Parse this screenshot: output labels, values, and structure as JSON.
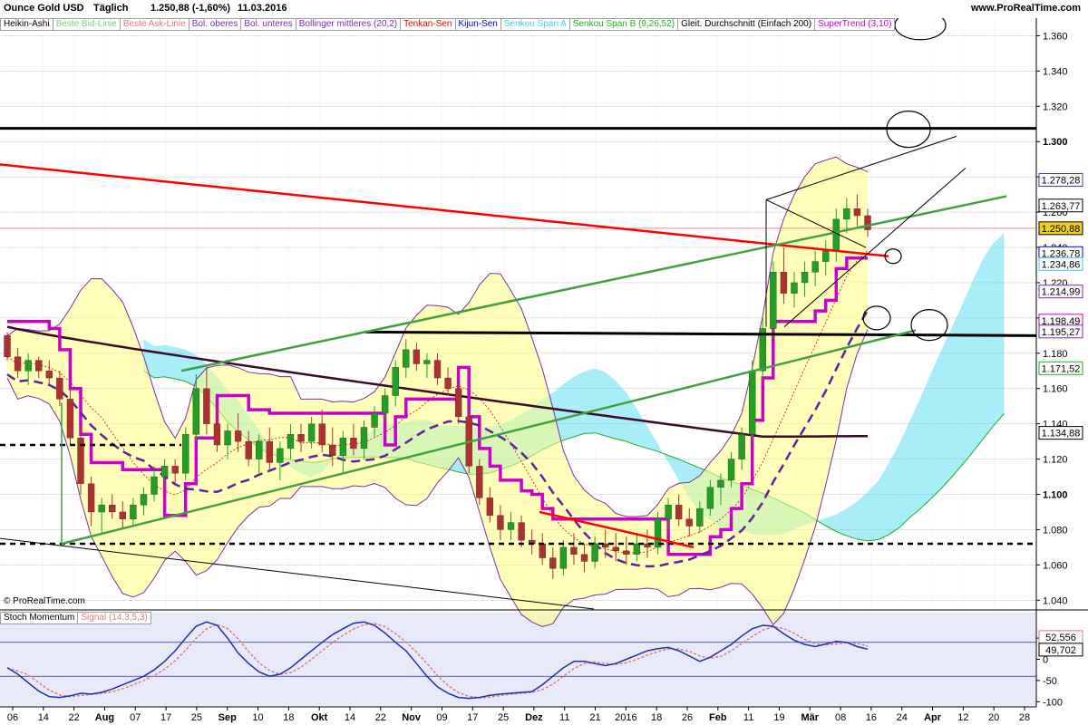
{
  "header": {
    "instrument": "Ounce Gold USD",
    "interval": "Täglich",
    "price": "1.250,88 (-1,60%)",
    "date": "11.03.2016",
    "site": "www.ProRealTime.com"
  },
  "copyright": "© ProRealTime.com",
  "legend": [
    {
      "label": "Heikin-Ashi",
      "color": "#000000"
    },
    {
      "label": "Beste Bid-Linie",
      "color": "#7ed07e"
    },
    {
      "label": "Beste Ask-Linie",
      "color": "#e07a7a"
    },
    {
      "label": "Bol. oberes",
      "color": "#7a2ea8"
    },
    {
      "label": "Bol. unteres",
      "color": "#7a2ea8"
    },
    {
      "label": "Bollinger mittleres (20,2)",
      "color": "#7a2ea8"
    },
    {
      "label": "Tenkan-Sen",
      "color": "#e00000"
    },
    {
      "label": "Kijun-Sen",
      "color": "#0000cc"
    },
    {
      "label": "Senkou Span A",
      "color": "#40d0f0"
    },
    {
      "label": "Senkou Span B (9,26,52)",
      "color": "#20b020"
    },
    {
      "label": "Gleit. Durchschnitt (Einfach 200)",
      "color": "#000000"
    },
    {
      "label": "SuperTrend (3,10)",
      "color": "#cc00cc"
    }
  ],
  "oscillator_legend": [
    {
      "label": "Stoch Momentum",
      "color": "#000000"
    },
    {
      "label": "Signal (14,3,5,3)",
      "color": "#e07a7a"
    }
  ],
  "chart_data": [
    {
      "type": "candlestick",
      "ylim": [
        1.035,
        1.37
      ],
      "y_ticks": [
        "1.040",
        "1.060",
        "1.080",
        "1.100",
        "1.120",
        "1.140",
        "1.160",
        "1.180",
        "1.200",
        "1.220",
        "1.240",
        "1.260",
        "1.280",
        "1.300",
        "1.320",
        "1.340",
        "1.360"
      ],
      "x_ticks": [
        "06",
        "14",
        "22",
        "Aug",
        "07",
        "17",
        "25",
        "Sep",
        "10",
        "18",
        "Okt",
        "14",
        "22",
        "Nov",
        "09",
        "17",
        "25",
        "Dez",
        "11",
        "21",
        "2016",
        "18",
        "26",
        "Feb",
        "11",
        "19",
        "Mär",
        "08",
        "16",
        "24",
        "Apr",
        "12",
        "20",
        "28"
      ],
      "candles": [
        [
          1.19,
          1.192,
          1.176,
          1.178
        ],
        [
          1.178,
          1.183,
          1.166,
          1.17
        ],
        [
          1.17,
          1.18,
          1.162,
          1.176
        ],
        [
          1.176,
          1.178,
          1.166,
          1.17
        ],
        [
          1.17,
          1.176,
          1.162,
          1.166
        ],
        [
          1.166,
          1.17,
          1.15,
          1.154
        ],
        [
          1.154,
          1.16,
          1.128,
          1.132
        ],
        [
          1.132,
          1.14,
          1.1,
          1.106
        ],
        [
          1.106,
          1.11,
          1.082,
          1.09
        ],
        [
          1.09,
          1.098,
          1.078,
          1.094
        ],
        [
          1.094,
          1.1,
          1.086,
          1.09
        ],
        [
          1.09,
          1.096,
          1.08,
          1.086
        ],
        [
          1.086,
          1.098,
          1.082,
          1.094
        ],
        [
          1.094,
          1.104,
          1.088,
          1.1
        ],
        [
          1.1,
          1.116,
          1.096,
          1.11
        ],
        [
          1.11,
          1.12,
          1.104,
          1.116
        ],
        [
          1.116,
          1.12,
          1.106,
          1.112
        ],
        [
          1.112,
          1.138,
          1.108,
          1.134
        ],
        [
          1.134,
          1.168,
          1.13,
          1.16
        ],
        [
          1.16,
          1.172,
          1.134,
          1.14
        ],
        [
          1.14,
          1.15,
          1.124,
          1.128
        ],
        [
          1.128,
          1.14,
          1.12,
          1.136
        ],
        [
          1.136,
          1.146,
          1.124,
          1.13
        ],
        [
          1.13,
          1.136,
          1.116,
          1.12
        ],
        [
          1.12,
          1.134,
          1.112,
          1.13
        ],
        [
          1.13,
          1.138,
          1.114,
          1.118
        ],
        [
          1.118,
          1.13,
          1.108,
          1.126
        ],
        [
          1.126,
          1.14,
          1.12,
          1.134
        ],
        [
          1.134,
          1.14,
          1.124,
          1.13
        ],
        [
          1.13,
          1.144,
          1.126,
          1.14
        ],
        [
          1.14,
          1.148,
          1.124,
          1.128
        ],
        [
          1.128,
          1.138,
          1.116,
          1.122
        ],
        [
          1.122,
          1.136,
          1.112,
          1.132
        ],
        [
          1.132,
          1.14,
          1.122,
          1.126
        ],
        [
          1.126,
          1.142,
          1.12,
          1.138
        ],
        [
          1.138,
          1.15,
          1.132,
          1.146
        ],
        [
          1.146,
          1.16,
          1.142,
          1.156
        ],
        [
          1.156,
          1.176,
          1.15,
          1.172
        ],
        [
          1.172,
          1.188,
          1.166,
          1.182
        ],
        [
          1.182,
          1.186,
          1.17,
          1.174
        ],
        [
          1.174,
          1.18,
          1.166,
          1.176
        ],
        [
          1.176,
          1.18,
          1.162,
          1.166
        ],
        [
          1.166,
          1.172,
          1.156,
          1.16
        ],
        [
          1.16,
          1.164,
          1.14,
          1.144
        ],
        [
          1.144,
          1.15,
          1.112,
          1.116
        ],
        [
          1.116,
          1.12,
          1.094,
          1.098
        ],
        [
          1.098,
          1.104,
          1.084,
          1.088
        ],
        [
          1.088,
          1.094,
          1.074,
          1.08
        ],
        [
          1.08,
          1.09,
          1.074,
          1.084
        ],
        [
          1.084,
          1.088,
          1.07,
          1.074
        ],
        [
          1.074,
          1.08,
          1.066,
          1.072
        ],
        [
          1.072,
          1.078,
          1.06,
          1.064
        ],
        [
          1.064,
          1.07,
          1.052,
          1.058
        ],
        [
          1.058,
          1.074,
          1.054,
          1.07
        ],
        [
          1.07,
          1.078,
          1.06,
          1.066
        ],
        [
          1.066,
          1.072,
          1.056,
          1.062
        ],
        [
          1.062,
          1.076,
          1.058,
          1.072
        ],
        [
          1.072,
          1.08,
          1.064,
          1.07
        ],
        [
          1.07,
          1.078,
          1.062,
          1.068
        ],
        [
          1.068,
          1.076,
          1.06,
          1.066
        ],
        [
          1.066,
          1.078,
          1.062,
          1.072
        ],
        [
          1.072,
          1.08,
          1.064,
          1.07
        ],
        [
          1.07,
          1.09,
          1.066,
          1.086
        ],
        [
          1.086,
          1.098,
          1.08,
          1.094
        ],
        [
          1.094,
          1.1,
          1.082,
          1.086
        ],
        [
          1.086,
          1.092,
          1.076,
          1.082
        ],
        [
          1.082,
          1.096,
          1.078,
          1.092
        ],
        [
          1.092,
          1.108,
          1.088,
          1.104
        ],
        [
          1.104,
          1.112,
          1.094,
          1.108
        ],
        [
          1.108,
          1.124,
          1.104,
          1.12
        ],
        [
          1.12,
          1.138,
          1.114,
          1.134
        ],
        [
          1.134,
          1.176,
          1.13,
          1.17
        ],
        [
          1.17,
          1.2,
          1.164,
          1.194
        ],
        [
          1.194,
          1.232,
          1.188,
          1.226
        ],
        [
          1.226,
          1.24,
          1.208,
          1.214
        ],
        [
          1.214,
          1.226,
          1.206,
          1.22
        ],
        [
          1.22,
          1.232,
          1.212,
          1.226
        ],
        [
          1.226,
          1.238,
          1.218,
          1.232
        ],
        [
          1.232,
          1.244,
          1.224,
          1.238
        ],
        [
          1.238,
          1.262,
          1.232,
          1.256
        ],
        [
          1.256,
          1.268,
          1.248,
          1.262
        ],
        [
          1.262,
          1.27,
          1.252,
          1.258
        ],
        [
          1.258,
          1.262,
          1.246,
          1.25
        ]
      ]
    },
    {
      "type": "line",
      "name": "Stoch Momentum",
      "ylim": [
        -110,
        110
      ],
      "y_ticks": [
        "50",
        "0",
        "-50",
        "-100"
      ],
      "series": [
        {
          "name": "Stoch Momentum",
          "values": [
            -20,
            -35,
            -55,
            -75,
            -88,
            -90,
            -86,
            -80,
            -82,
            -78,
            -70,
            -60,
            -50,
            -40,
            -25,
            -5,
            20,
            50,
            78,
            88,
            80,
            50,
            15,
            -10,
            -30,
            -40,
            -35,
            -20,
            0,
            20,
            40,
            58,
            72,
            85,
            88,
            80,
            62,
            40,
            20,
            -10,
            -40,
            -65,
            -80,
            -90,
            -92,
            -90,
            -85,
            -82,
            -80,
            -78,
            -76,
            -60,
            -40,
            -20,
            -5,
            -5,
            -10,
            -15,
            -10,
            0,
            10,
            20,
            25,
            28,
            20,
            8,
            -5,
            5,
            20,
            35,
            55,
            72,
            80,
            78,
            60,
            45,
            35,
            30,
            36,
            42,
            40,
            30,
            24
          ]
        }
      ]
    }
  ],
  "price_labels": [
    {
      "text": "1.278,28",
      "value": 1.27828,
      "border": "#4040a0",
      "bg": "#ffffff"
    },
    {
      "text": "1.263,77",
      "value": 1.26377,
      "border": "#000000",
      "bg": "#ffffff"
    },
    {
      "text": "1.250,88",
      "value": 1.25088,
      "border": "#000000",
      "bg": "#f0d020"
    },
    {
      "text": "1.236,78",
      "value": 1.23678,
      "border": "#0000cc",
      "bg": "#ffffff"
    },
    {
      "text": "1.234,86",
      "value": 1.23486,
      "border": "#40c0e0",
      "bg": "#ffffff"
    },
    {
      "text": "1.214,99",
      "value": 1.21499,
      "border": "#7a2ea8",
      "bg": "#ffffff"
    },
    {
      "text": "1.198,49",
      "value": 1.19849,
      "border": "#cc00cc",
      "bg": "#ffffff"
    },
    {
      "text": "1.195,27",
      "value": 1.19527,
      "border": "#7a2ea8",
      "bg": "#ffffff"
    },
    {
      "text": "1.171,52",
      "value": 1.17152,
      "border": "#20b020",
      "bg": "#ffffff"
    },
    {
      "text": "1.134,88",
      "value": 1.13488,
      "border": "#000000",
      "bg": "#ffffff"
    }
  ],
  "osc_labels": [
    {
      "text": "52,556",
      "value": 52.556,
      "border": "#e07a7a"
    },
    {
      "text": "49,702",
      "value": 49.702,
      "border": "#000000"
    }
  ],
  "colors": {
    "bull": "#20a020",
    "bear": "#b03030",
    "grid": "#c8c8c8",
    "supertrend": "#cc00cc",
    "sma200": "#3a0a2a",
    "resistance": "#ff0000",
    "trend": "#40a040",
    "boll_fill": "#ffff80"
  }
}
